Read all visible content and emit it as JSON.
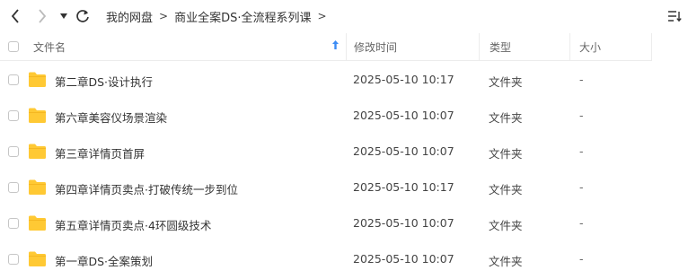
{
  "toolbar": {
    "breadcrumbs": [
      "我的网盘",
      "商业全案DS·全流程系列课"
    ],
    "separator": ">"
  },
  "table": {
    "columns": {
      "name": "文件名",
      "modified": "修改时间",
      "type": "类型",
      "size": "大小"
    },
    "sort": {
      "column": "name",
      "direction": "asc"
    },
    "rows": [
      {
        "name": "第二章DS·设计执行",
        "modified": "2025-05-10 10:17",
        "type": "文件夹",
        "size": "-"
      },
      {
        "name": "第六章美容仪场景渲染",
        "modified": "2025-05-10 10:07",
        "type": "文件夹",
        "size": "-"
      },
      {
        "name": "第三章详情页首屏",
        "modified": "2025-05-10 10:07",
        "type": "文件夹",
        "size": "-"
      },
      {
        "name": "第四章详情页卖点·打破传统一步到位",
        "modified": "2025-05-10 10:17",
        "type": "文件夹",
        "size": "-"
      },
      {
        "name": "第五章详情页卖点·4环圆级技术",
        "modified": "2025-05-10 10:07",
        "type": "文件夹",
        "size": "-"
      },
      {
        "name": "第一章DS·全案策划",
        "modified": "2025-05-10 10:07",
        "type": "文件夹",
        "size": "-"
      }
    ]
  },
  "icons": {
    "back": "chevron-left-icon",
    "forward": "chevron-right-icon",
    "history": "caret-down-icon",
    "refresh": "refresh-icon",
    "sort_toggle": "sort-list-icon",
    "row": "folder-icon"
  },
  "colors": {
    "folder": "#FFC934",
    "sort_arrow": "#3B8CF5",
    "forward_disabled": "#BBBBBB"
  }
}
